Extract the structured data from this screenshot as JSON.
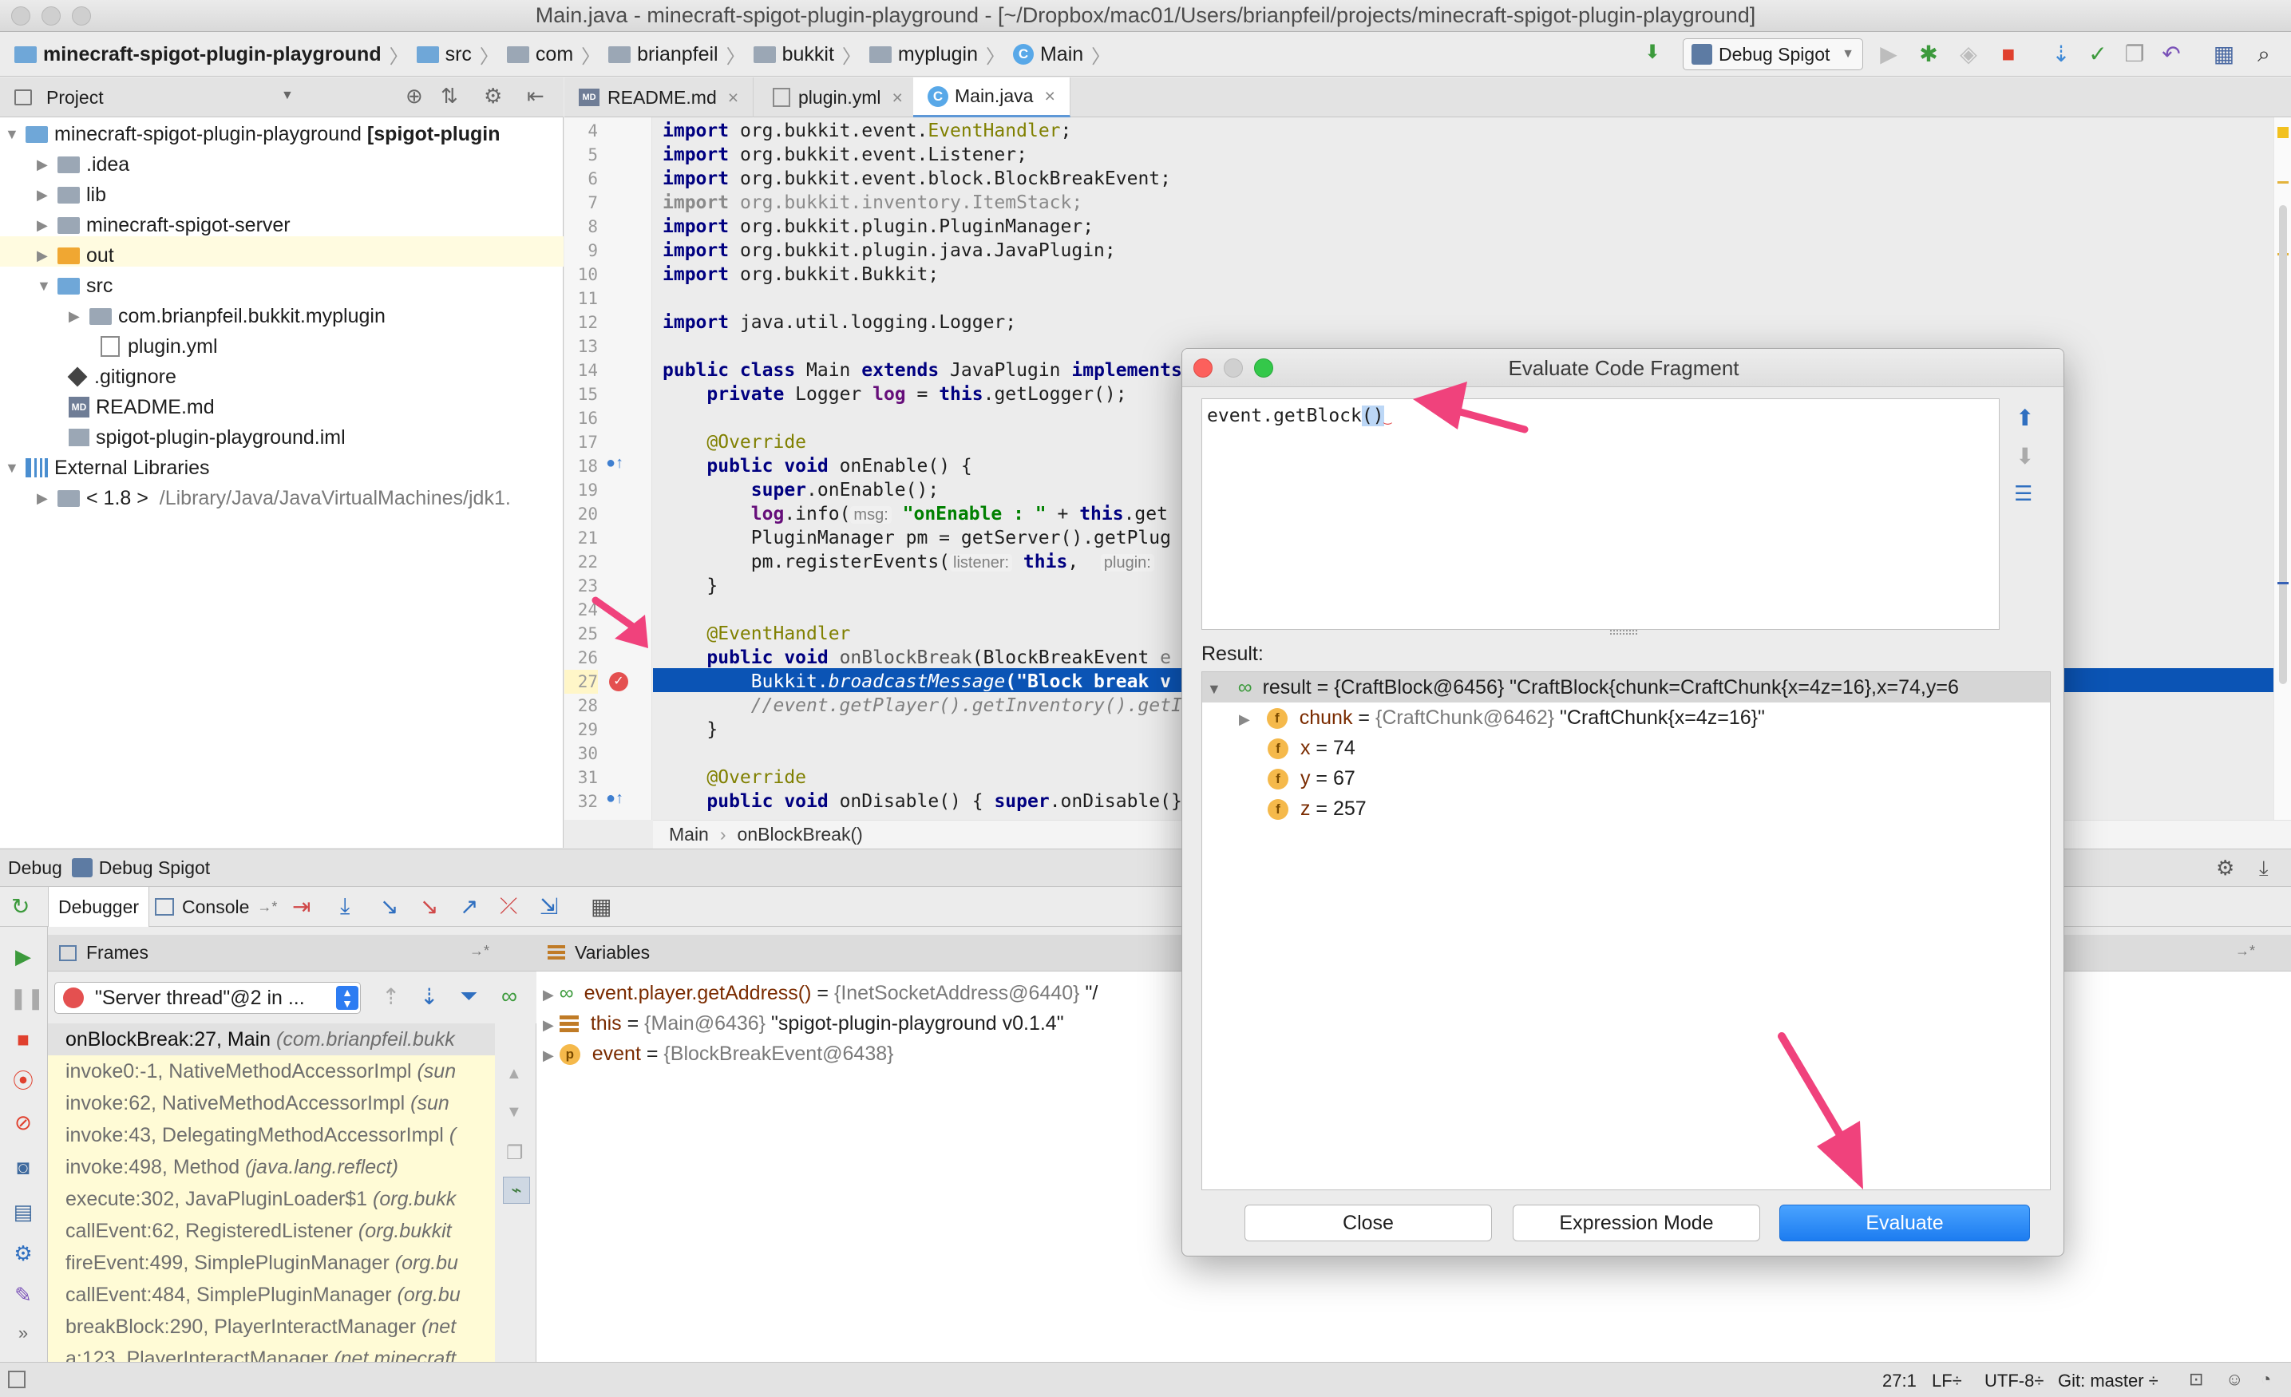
{
  "window": {
    "title": "Main.java - minecraft-spigot-plugin-playground - [~/Dropbox/mac01/Users/brianpfeil/projects/minecraft-spigot-plugin-playground]"
  },
  "navbar": {
    "crumbs": [
      "minecraft-spigot-plugin-playground",
      "src",
      "com",
      "brianpfeil",
      "bukkit",
      "myplugin",
      "Main"
    ],
    "run_config": "Debug Spigot"
  },
  "project_panel": {
    "title": "Project",
    "tree": [
      {
        "label": "minecraft-spigot-plugin-playground",
        "suffix": "[spigot-plugin",
        "level": 0,
        "expanded": true,
        "icon": "module-folder-icon"
      },
      {
        "label": ".idea",
        "level": 1,
        "expanded": false,
        "icon": "folder-icon"
      },
      {
        "label": "lib",
        "level": 1,
        "expanded": false,
        "icon": "folder-icon"
      },
      {
        "label": "minecraft-spigot-server",
        "level": 1,
        "expanded": false,
        "icon": "folder-icon"
      },
      {
        "label": "out",
        "level": 1,
        "expanded": false,
        "icon": "excluded-folder-icon"
      },
      {
        "label": "src",
        "level": 1,
        "expanded": true,
        "icon": "source-folder-icon"
      },
      {
        "label": "com.brianpfeil.bukkit.myplugin",
        "level": 2,
        "expanded": false,
        "icon": "package-icon"
      },
      {
        "label": "plugin.yml",
        "level": 2,
        "icon": "yml-file-icon"
      },
      {
        "label": ".gitignore",
        "level": 1,
        "icon": "gitignore-file-icon"
      },
      {
        "label": "README.md",
        "level": 1,
        "icon": "markdown-file-icon"
      },
      {
        "label": "spigot-plugin-playground.iml",
        "level": 1,
        "icon": "iml-file-icon"
      },
      {
        "label": "External Libraries",
        "level": 0,
        "expanded": true,
        "icon": "libraries-icon"
      },
      {
        "label": "< 1.8 >",
        "suffix": "/Library/Java/JavaVirtualMachines/jdk1.",
        "level": 1,
        "expanded": false,
        "icon": "jdk-icon"
      }
    ]
  },
  "editor": {
    "tabs": [
      {
        "label": "README.md",
        "icon": "markdown-file-icon"
      },
      {
        "label": "plugin.yml",
        "icon": "yml-file-icon"
      },
      {
        "label": "Main.java",
        "icon": "java-class-icon",
        "active": true
      }
    ],
    "line_numbers": [
      "4",
      "5",
      "6",
      "7",
      "8",
      "9",
      "10",
      "11",
      "12",
      "13",
      "14",
      "15",
      "16",
      "17",
      "18",
      "19",
      "20",
      "21",
      "22",
      "23",
      "24",
      "25",
      "26",
      "27",
      "28",
      "29",
      "30",
      "31",
      "32"
    ],
    "lines": {
      "l4": [
        "import",
        " org.bukkit.event.",
        "EventHandler",
        ";"
      ],
      "l5": [
        "import",
        " org.bukkit.event.Listener;"
      ],
      "l6": [
        "import",
        " org.bukkit.event.block.BlockBreakEvent;"
      ],
      "l7": [
        "import",
        " org.bukkit.inventory.ItemStack;"
      ],
      "l8": [
        "import",
        " org.bukkit.plugin.PluginManager;"
      ],
      "l9": [
        "import",
        " org.bukkit.plugin.java.JavaPlugin;"
      ],
      "l10": [
        "import",
        " org.bukkit.Bukkit;"
      ],
      "l12": [
        "import",
        " java.util.logging.Logger;"
      ],
      "l14": [
        "public class",
        " Main ",
        "extends",
        " JavaPlugin ",
        "implements"
      ],
      "l15": [
        "private",
        " Logger ",
        "log",
        " = ",
        "this",
        ".getLogger();"
      ],
      "l17": "@Override",
      "l18": [
        "public void",
        " onEnable() {"
      ],
      "l19": [
        "super",
        ".onEnable();"
      ],
      "l20": [
        "log",
        ".info(",
        "msg:",
        "\"onEnable : \"",
        " + ",
        "this",
        ".get"
      ],
      "l21": "PluginManager pm = getServer().getPlug",
      "l22": [
        "pm.registerEvents(",
        "listener:",
        "this",
        ",",
        "plugin:"
      ],
      "l23": "}",
      "l25": "@EventHandler",
      "l26": [
        "public void",
        " onBlockBreak",
        "(BlockBreakEvent ",
        "e"
      ],
      "l27": [
        "Bukkit.",
        "broadcastMessage",
        "(\"Block break v"
      ],
      "l28": "//event.getPlayer().getInventory().getI",
      "l29": "}",
      "l31": "@Override",
      "l32": [
        "public void",
        " onDisable() { ",
        "super",
        ".onDisable(",
        "}"
      ]
    },
    "breadcrumb": [
      "Main",
      "onBlockBreak()"
    ]
  },
  "debug_panel": {
    "title": "Debug",
    "config": "Debug Spigot",
    "tabs": [
      "Debugger",
      "Console"
    ],
    "frames_title": "Frames",
    "variables_title": "Variables",
    "thread": "\"Server thread\"@2 in ...",
    "frames": [
      {
        "method": "onBlockBreak:27, Main",
        "pkg": "(com.brianpfeil.bukk",
        "selected": true
      },
      {
        "method": "invoke0:-1, NativeMethodAccessorImpl",
        "pkg": "(sun"
      },
      {
        "method": "invoke:62, NativeMethodAccessorImpl",
        "pkg": "(sun"
      },
      {
        "method": "invoke:43, DelegatingMethodAccessorImpl",
        "pkg": "("
      },
      {
        "method": "invoke:498, Method",
        "pkg": "(java.lang.reflect)"
      },
      {
        "method": "execute:302, JavaPluginLoader$1",
        "pkg": "(org.bukk"
      },
      {
        "method": "callEvent:62, RegisteredListener",
        "pkg": "(org.bukkit"
      },
      {
        "method": "fireEvent:499, SimplePluginManager",
        "pkg": "(org.bu"
      },
      {
        "method": "callEvent:484, SimplePluginManager",
        "pkg": "(org.bu"
      },
      {
        "method": "breakBlock:290, PlayerInteractManager",
        "pkg": "(net"
      },
      {
        "method": "a:123, PlayerInteractManager",
        "pkg": "(net.minecraft"
      }
    ],
    "variables": [
      {
        "name": "event.player.getAddress()",
        "ref": "{InetSocketAddress@6440}",
        "value": "\"/",
        "icon": "watch-icon"
      },
      {
        "name": "this",
        "ref": "{Main@6436}",
        "value": "\"spigot-plugin-playground v0.1.4\"",
        "icon": "object-icon"
      },
      {
        "name": "event",
        "ref": "{BlockBreakEvent@6438}",
        "value": "",
        "icon": "parameter-icon"
      }
    ]
  },
  "status_bar": {
    "position": "27:1",
    "line_sep": "LF÷",
    "encoding": "UTF-8÷",
    "vcs": "Git: master ÷"
  },
  "dialog": {
    "title": "Evaluate Code Fragment",
    "expression_prefix": "event.getBlock",
    "expression_parens": "()",
    "result_label": "Result:",
    "result_rows": [
      {
        "name": "result",
        "eq": " = ",
        "ref": "{CraftBlock@6456}",
        "value": " \"CraftBlock{chunk=CraftChunk{x=4z=16},x=74,y=6",
        "level": 0,
        "icon": "watch-icon",
        "selected": true
      },
      {
        "name": "chunk",
        "eq": " = ",
        "ref": "{CraftChunk@6462}",
        "value": " \"CraftChunk{x=4z=16}\"",
        "level": 1,
        "icon": "field-icon",
        "expandable": true
      },
      {
        "name": "x",
        "eq": " = ",
        "ref": "",
        "value": "74",
        "level": 1,
        "icon": "field-icon"
      },
      {
        "name": "y",
        "eq": " = ",
        "ref": "",
        "value": "67",
        "level": 1,
        "icon": "field-icon"
      },
      {
        "name": "z",
        "eq": " = ",
        "ref": "",
        "value": "257",
        "level": 1,
        "icon": "field-icon"
      }
    ],
    "buttons": {
      "close": "Close",
      "mode": "Expression Mode",
      "evaluate": "Evaluate"
    }
  },
  "colors": {
    "accent": "#1c7cf0",
    "current_line": "#0b54b5",
    "annotation_arrow": "#f0427c",
    "keyword": "#000080",
    "string": "#008000",
    "frames_bg": "#fffbd6"
  }
}
